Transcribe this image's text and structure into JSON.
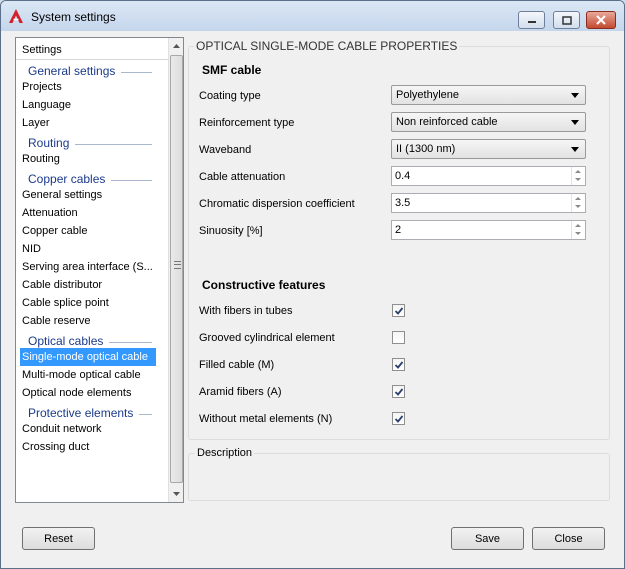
{
  "window": {
    "title": "System settings"
  },
  "sidebar": {
    "header": "Settings",
    "items": [
      {
        "type": "group",
        "label": "General settings"
      },
      {
        "type": "item",
        "label": "Projects"
      },
      {
        "type": "item",
        "label": "Language"
      },
      {
        "type": "item",
        "label": "Layer"
      },
      {
        "type": "group",
        "label": "Routing"
      },
      {
        "type": "item",
        "label": "Routing"
      },
      {
        "type": "group",
        "label": "Copper cables"
      },
      {
        "type": "item",
        "label": "General settings"
      },
      {
        "type": "item",
        "label": "Attenuation"
      },
      {
        "type": "item",
        "label": "Copper cable"
      },
      {
        "type": "item",
        "label": "NID"
      },
      {
        "type": "item",
        "label": "Serving area interface (S..."
      },
      {
        "type": "item",
        "label": "Cable distributor"
      },
      {
        "type": "item",
        "label": "Cable splice point"
      },
      {
        "type": "item",
        "label": "Cable reserve"
      },
      {
        "type": "group",
        "label": "Optical cables"
      },
      {
        "type": "item",
        "label": "Single-mode optical cable",
        "selected": true
      },
      {
        "type": "item",
        "label": "Multi-mode optical cable"
      },
      {
        "type": "item",
        "label": "Optical node elements"
      },
      {
        "type": "group",
        "label": "Protective elements"
      },
      {
        "type": "item",
        "label": "Conduit network"
      },
      {
        "type": "item",
        "label": "Crossing duct"
      }
    ]
  },
  "panel": {
    "title": "OPTICAL SINGLE-MODE CABLE PROPERTIES",
    "smf_section": "SMF cable",
    "coating": {
      "label": "Coating type",
      "value": "Polyethylene"
    },
    "reinforcement": {
      "label": "Reinforcement type",
      "value": "Non reinforced cable"
    },
    "waveband": {
      "label": "Waveband",
      "value": "II (1300 nm)"
    },
    "attenuation": {
      "label": "Cable attenuation",
      "value": "0.4"
    },
    "dispersion": {
      "label": "Chromatic dispersion coefficient",
      "value": "3.5"
    },
    "sinuosity": {
      "label": "Sinuosity [%]",
      "value": "2"
    },
    "constructive_section": "Constructive features",
    "features": [
      {
        "label": "With fibers in tubes",
        "checked": true
      },
      {
        "label": "Grooved cylindrical element",
        "checked": false
      },
      {
        "label": "Filled cable (M)",
        "checked": true
      },
      {
        "label": "Aramid fibers (A)",
        "checked": true
      },
      {
        "label": "Without metal elements (N)",
        "checked": true
      }
    ],
    "description_label": "Description"
  },
  "footer": {
    "reset": "Reset",
    "save": "Save",
    "close": "Close"
  },
  "colors": {
    "selection": "#3399ff",
    "group_heading": "#1a3a8a",
    "close_button": "#c44a30"
  }
}
